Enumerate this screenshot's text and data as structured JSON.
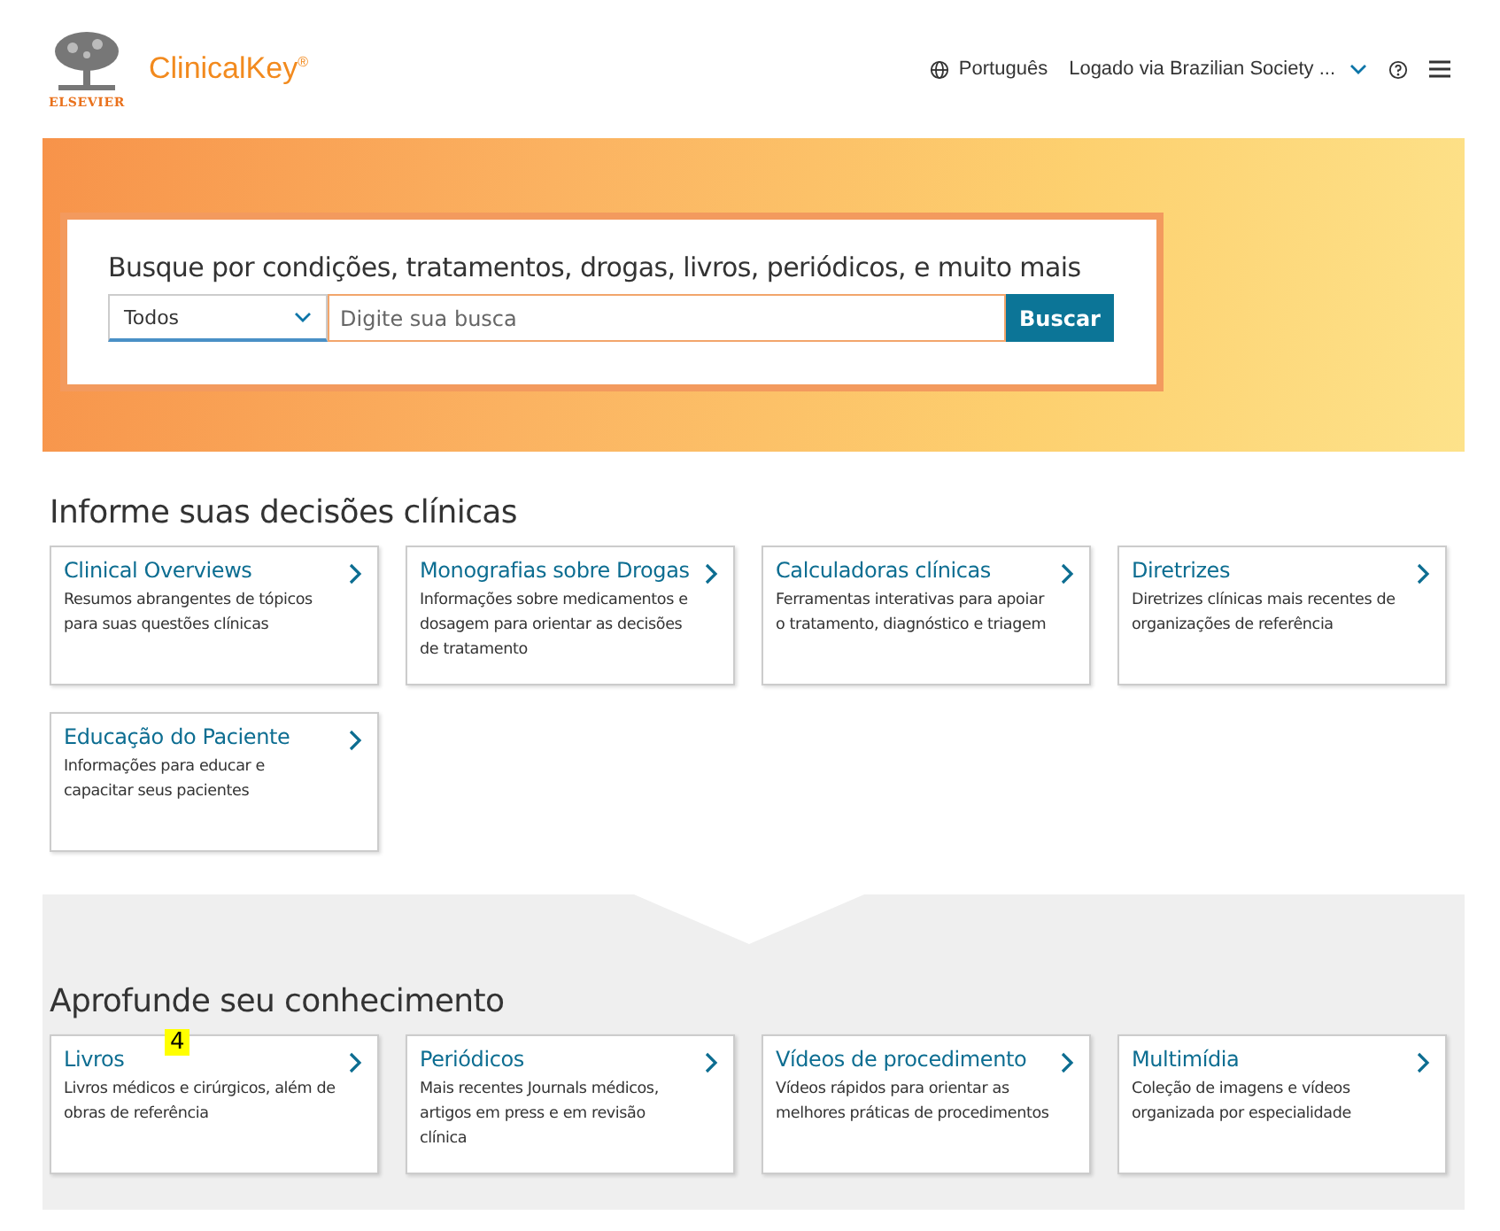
{
  "header": {
    "publisher": "ELSEVIER",
    "product": "ClinicalKey$^{®}$",
    "language": "Português",
    "account": "Logado via Brazilian Society ..."
  },
  "search": {
    "heading": "Busque por condições, tratamentos, drogas, livros, periódicos, e muito mais",
    "scope": "Todos",
    "placeholder": "Digite sua busca",
    "button": "Buscar"
  },
  "sections": [
    {
      "title": "Informe suas decisões clínicas",
      "cards": [
        {
          "title": "Clinical Overviews",
          "text": "Resumos abrangentes de tópicos para suas questões clínicas"
        },
        {
          "title": "Monografias sobre Drogas",
          "text": "Informações sobre medicamentos e dosagem para orientar as decisões de tratamento"
        },
        {
          "title": "Calculadoras clínicas",
          "text": "Ferramentas interativas para apoiar o tratamento, diagnóstico e triagem"
        },
        {
          "title": "Diretrizes",
          "text": "Diretrizes clínicas mais recentes de organizações de referência"
        },
        {
          "title": "Educação do Paciente",
          "text": "Informações para educar e capacitar seus pacientes"
        }
      ]
    },
    {
      "title": "Aprofunde seu conhecimento",
      "cards": [
        {
          "title": "Livros",
          "text": "Livros médicos e cirúrgicos, além de obras de referência",
          "badge": "4"
        },
        {
          "title": "Periódicos",
          "text": "Mais recentes Journals médicos, artigos em press e em revisão clínica"
        },
        {
          "title": "Vídeos de procedimento",
          "text": "Vídeos rápidos para orientar as melhores práticas de procedimentos"
        },
        {
          "title": "Multimídia",
          "text": "Coleção de imagens e vídeos organizada por especialidade"
        }
      ]
    }
  ]
}
